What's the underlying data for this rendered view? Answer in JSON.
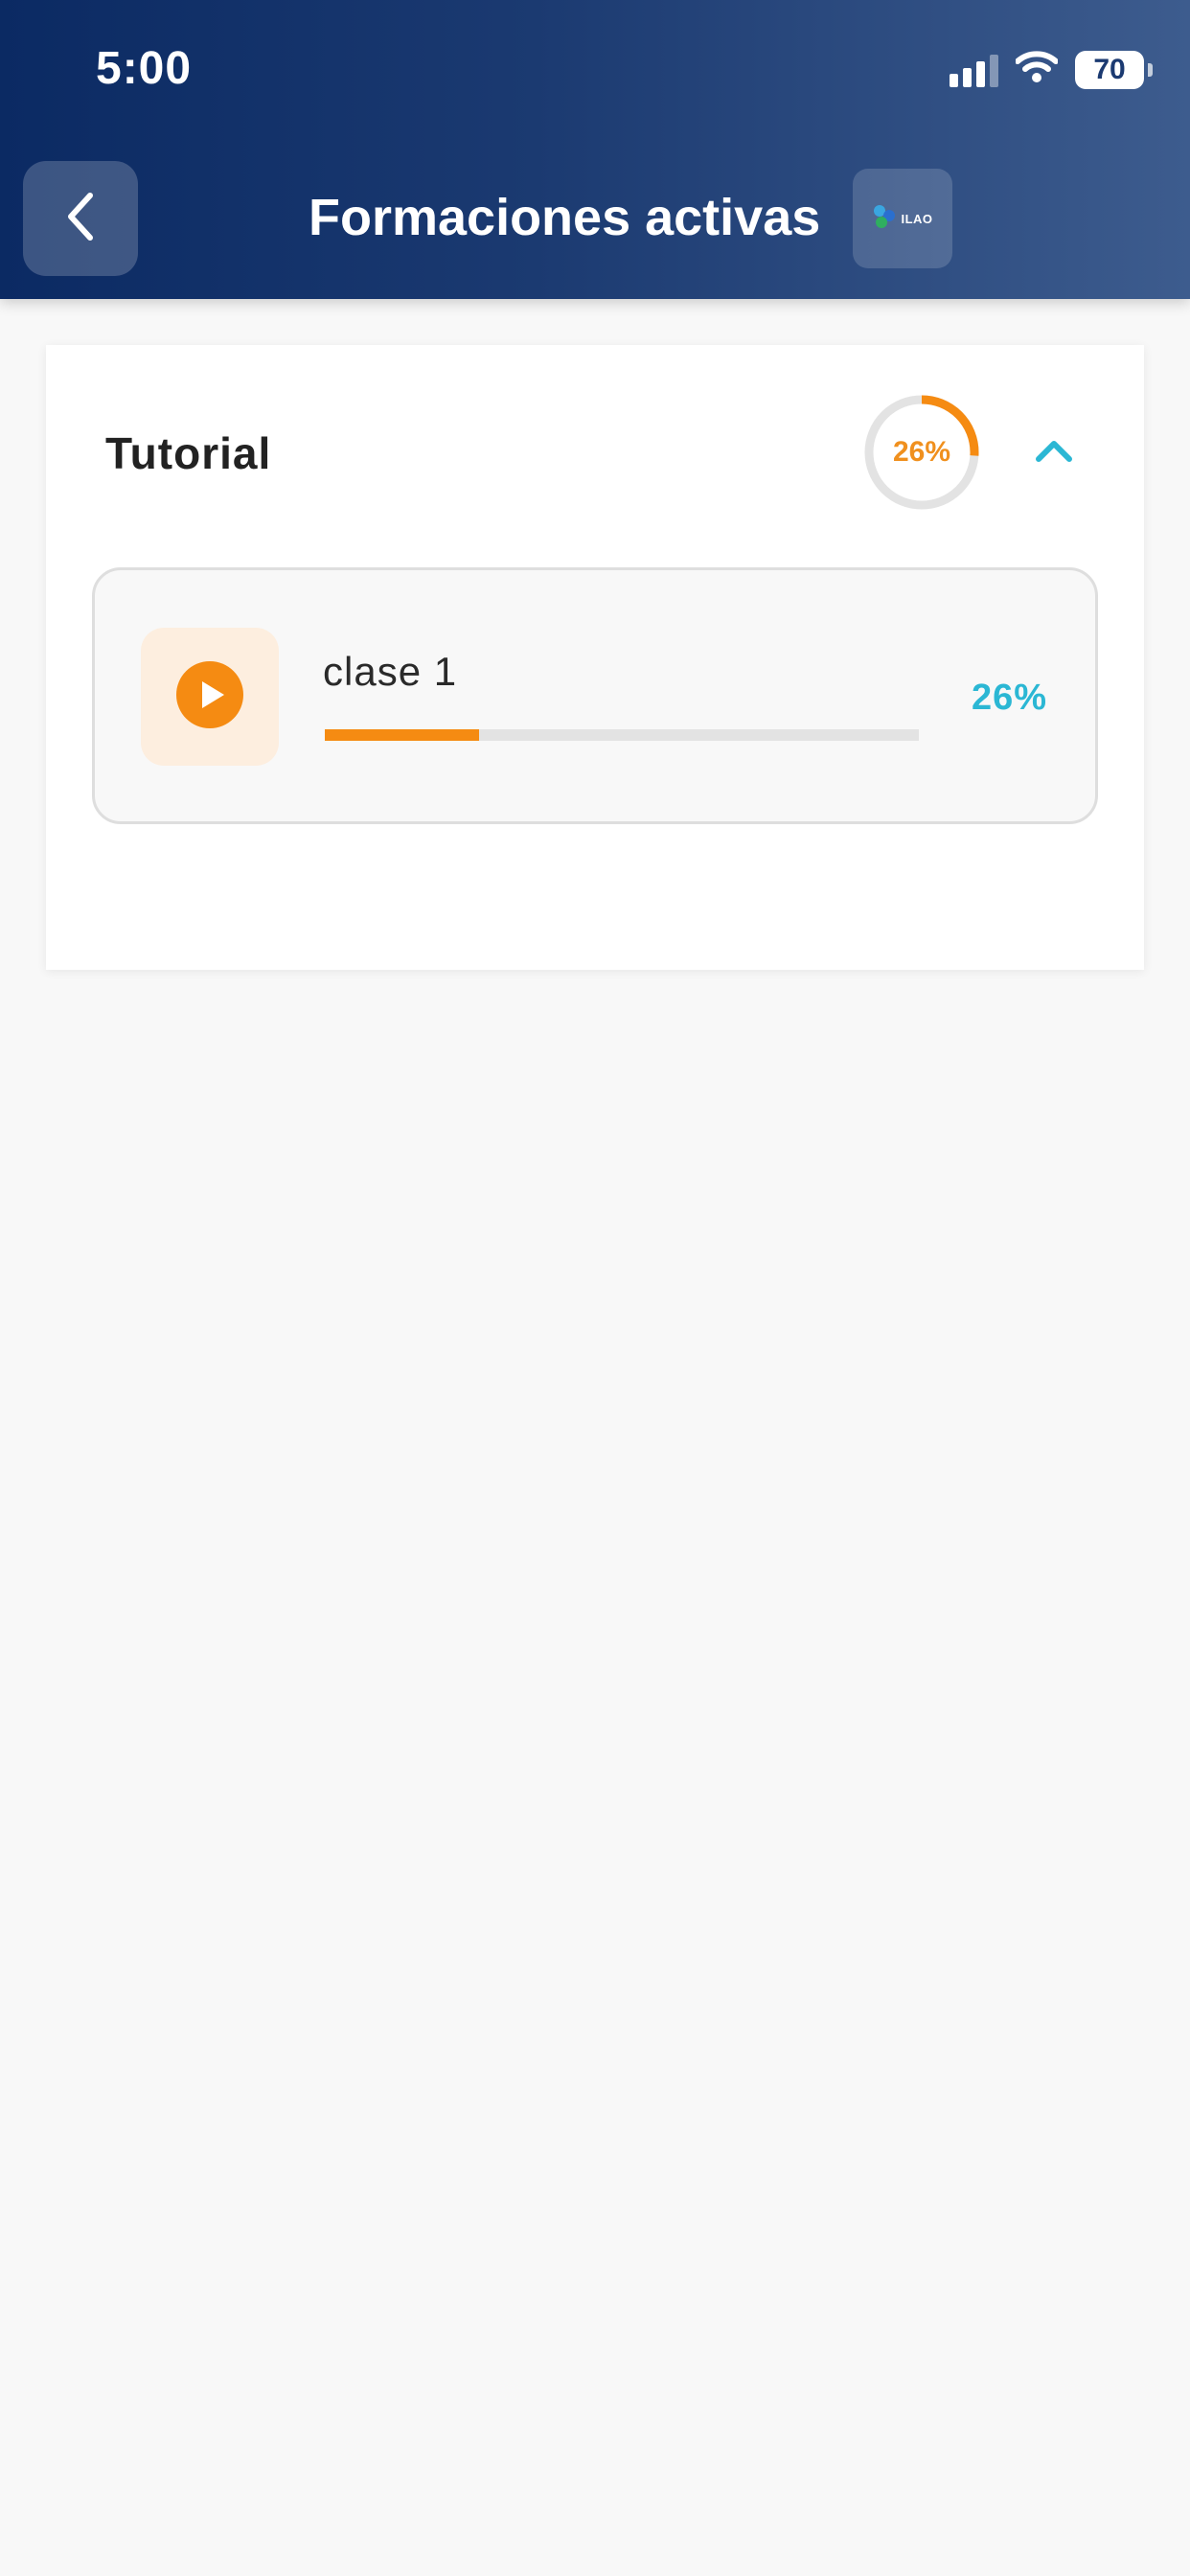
{
  "status_bar": {
    "time": "5:00",
    "battery_level": "70",
    "icons": [
      "signal-icon",
      "wifi-icon",
      "battery-icon"
    ]
  },
  "header": {
    "title": "Formaciones activas",
    "back_icon": "chevron-left-icon",
    "logo_text": "ILAO",
    "background_colors": [
      "#0b2a63",
      "#3d5c8e"
    ]
  },
  "course": {
    "title": "Tutorial",
    "progress_label": "26%",
    "progress_value": 0.26,
    "expanded": true,
    "collapse_icon": "chevron-up-icon",
    "lessons": [
      {
        "name": "clase 1",
        "icon": "play-icon",
        "progress_label": "26%",
        "progress_value": 0.26
      }
    ]
  },
  "colors": {
    "accent_orange": "#f58b12",
    "accent_cyan": "#2bb7d4",
    "ring_track": "#e3e3e3"
  }
}
